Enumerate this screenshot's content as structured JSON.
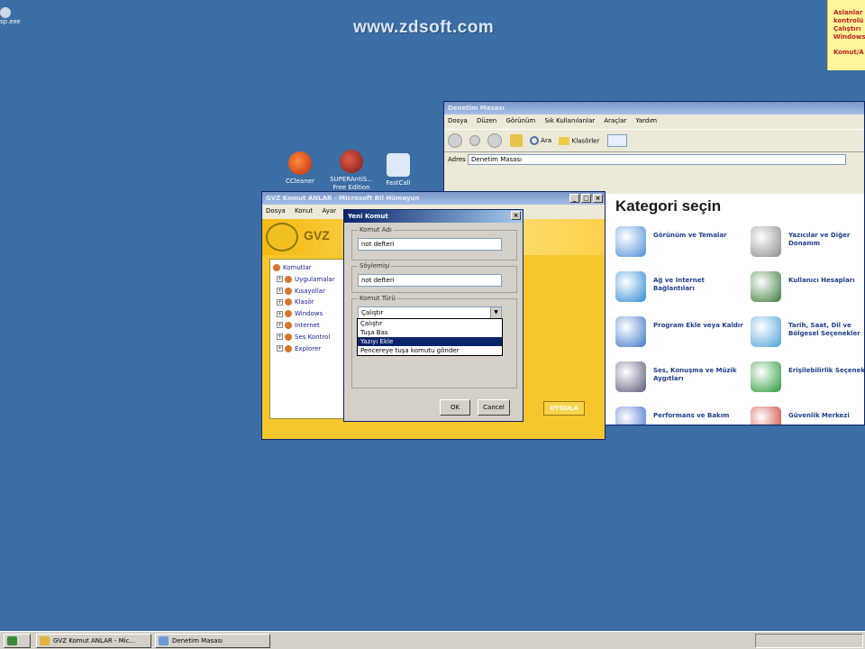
{
  "watermark": "www.zdsoft.com",
  "desktop": {
    "icons": [
      {
        "label": "CCleaner"
      },
      {
        "label": "SUPERAntiS... Free Edition"
      },
      {
        "label": "FastCall"
      }
    ],
    "partial_icon_label": "sp.exe",
    "sticky_note": [
      "Aslanlar",
      "kontrolü",
      "Çalıştırı",
      "Windows",
      "Komut/A"
    ]
  },
  "control_panel": {
    "title": "Denetim Masası",
    "menu": [
      "Dosya",
      "Düzen",
      "Görünüm",
      "Sık Kullanılanlar",
      "Araçlar",
      "Yardım"
    ],
    "toolbar": {
      "search": "Ara",
      "folders": "Klasörler"
    },
    "address_label": "Adres",
    "address_value": "Denetim Masası",
    "heading": "Kategori seçin",
    "categories": [
      {
        "label": "Görünüm ve Temalar",
        "color": "#4a8fd8"
      },
      {
        "label": "Yazıcılar ve Diğer Donanım",
        "color": "#8a8a8a"
      },
      {
        "label": "Ağ ve Internet Bağlantıları",
        "color": "#2d8bd4"
      },
      {
        "label": "Kullanıcı Hesapları",
        "color": "#3a7a3a"
      },
      {
        "label": "Program Ekle veya Kaldır",
        "color": "#3c78c8"
      },
      {
        "label": "Tarih, Saat, Dil ve Bölgesel Seçenekler",
        "color": "#4aa0d8"
      },
      {
        "label": "Ses, Konuşma ve Müzik Aygıtları",
        "color": "#5a5a7a"
      },
      {
        "label": "Erişilebilirlik Seçenekleri",
        "color": "#2a9a3a"
      },
      {
        "label": "Performans ve Bakım",
        "color": "#3b6cc8"
      },
      {
        "label": "Güvenlik Merkezi",
        "color": "#c8382a"
      }
    ]
  },
  "gvz": {
    "title": "GVZ Komut ANLAR - Microsoft Bil Hümayun",
    "menu": [
      "Dosya",
      "Konut",
      "Ayar"
    ],
    "brand": "GVZ",
    "tree": {
      "root": "Komutlar",
      "children": [
        "Uygulamalar",
        "Kısayollar",
        "Klasör",
        "Windows",
        "Internet",
        "Ses Kontrol",
        "Explorer"
      ]
    },
    "button_label": "UYGULA"
  },
  "dialog": {
    "title": "Yeni Komut",
    "name_label": "Komut Adı",
    "name_value": "not defteri",
    "speech_label": "Söylemişi",
    "speech_value": "not defteri",
    "type_label": "Komut Türü",
    "type_value": "Çalıştır",
    "type_options": [
      "Çalıştır",
      "Tuşa Bas",
      "Yazıyı Ekle",
      "Pencereye tuşa komutu gönder"
    ],
    "selected_option": "Yazıyı Ekle",
    "ok_label": "OK",
    "cancel_label": "Cancel"
  },
  "taskbar": {
    "tasks": [
      {
        "label": "GVZ Komut ANLAR - Mic..."
      },
      {
        "label": "Denetim Masası"
      }
    ]
  }
}
